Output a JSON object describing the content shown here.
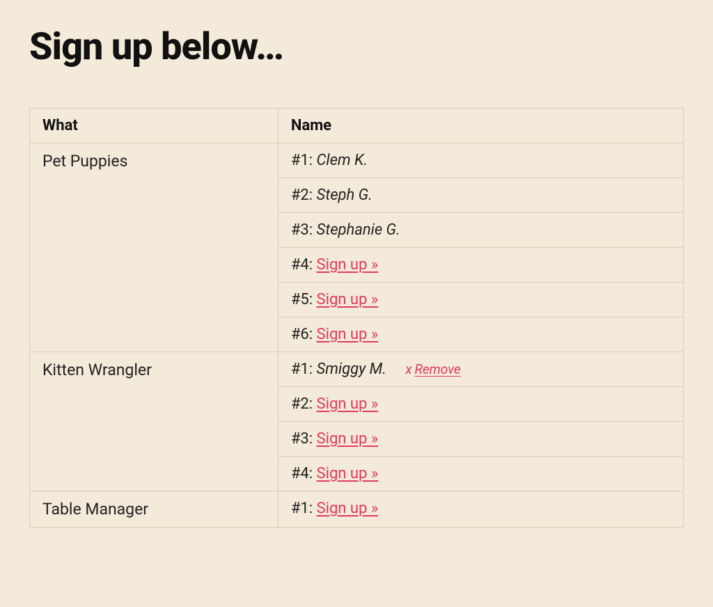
{
  "title": "Sign up below…",
  "columns": {
    "what": "What",
    "name": "Name"
  },
  "signup_label": "Sign up »",
  "remove_label": "Remove",
  "remove_x": "x",
  "tasks": [
    {
      "what": "Pet Puppies",
      "slots": [
        {
          "num": "#1:",
          "name": "Clem K."
        },
        {
          "num": "#2:",
          "name": "Steph G."
        },
        {
          "num": "#3:",
          "name": "Stephanie G."
        },
        {
          "num": "#4:",
          "signup": true
        },
        {
          "num": "#5:",
          "signup": true
        },
        {
          "num": "#6:",
          "signup": true
        }
      ]
    },
    {
      "what": "Kitten Wrangler",
      "slots": [
        {
          "num": "#1:",
          "name": "Smiggy M.",
          "removable": true
        },
        {
          "num": "#2:",
          "signup": true
        },
        {
          "num": "#3:",
          "signup": true
        },
        {
          "num": "#4:",
          "signup": true
        }
      ]
    },
    {
      "what": "Table Manager",
      "slots": [
        {
          "num": "#1:",
          "signup": true
        }
      ]
    }
  ]
}
